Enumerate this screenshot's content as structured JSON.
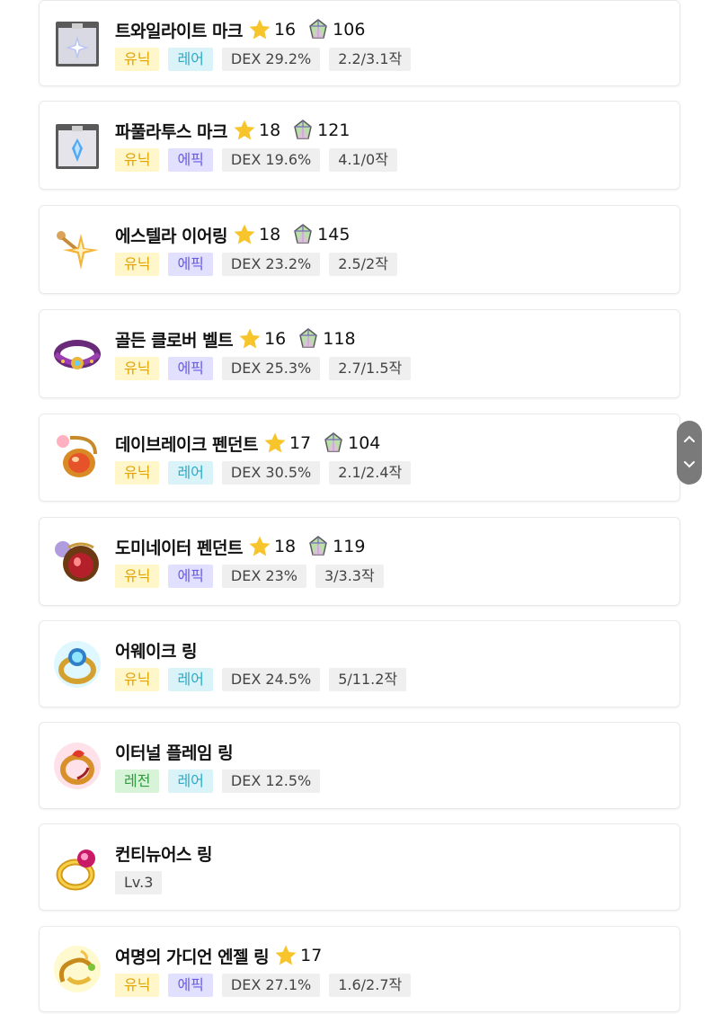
{
  "items": [
    {
      "name": "트와일라이트 마크",
      "stars": "16",
      "power": "106",
      "icon": "twilight-mark-icon",
      "tags": [
        {
          "text": "유닉",
          "kind": "unique"
        },
        {
          "text": "레어",
          "kind": "rare"
        },
        {
          "text": "DEX 29.2%",
          "kind": "stat"
        },
        {
          "text": "2.2/3.1작",
          "kind": "stat"
        }
      ]
    },
    {
      "name": "파풀라투스 마크",
      "stars": "18",
      "power": "121",
      "icon": "papulatus-mark-icon",
      "tags": [
        {
          "text": "유닉",
          "kind": "unique"
        },
        {
          "text": "에픽",
          "kind": "epic"
        },
        {
          "text": "DEX 19.6%",
          "kind": "stat"
        },
        {
          "text": "4.1/0작",
          "kind": "stat"
        }
      ]
    },
    {
      "name": "에스텔라 이어링",
      "stars": "18",
      "power": "145",
      "icon": "estella-earring-icon",
      "tags": [
        {
          "text": "유닉",
          "kind": "unique"
        },
        {
          "text": "에픽",
          "kind": "epic"
        },
        {
          "text": "DEX 23.2%",
          "kind": "stat"
        },
        {
          "text": "2.5/2작",
          "kind": "stat"
        }
      ]
    },
    {
      "name": "골든 클로버 벨트",
      "stars": "16",
      "power": "118",
      "icon": "golden-clover-belt-icon",
      "tags": [
        {
          "text": "유닉",
          "kind": "unique"
        },
        {
          "text": "에픽",
          "kind": "epic"
        },
        {
          "text": "DEX 25.3%",
          "kind": "stat"
        },
        {
          "text": "2.7/1.5작",
          "kind": "stat"
        }
      ]
    },
    {
      "name": "데이브레이크 펜던트",
      "stars": "17",
      "power": "104",
      "icon": "daybreak-pendant-icon",
      "tags": [
        {
          "text": "유닉",
          "kind": "unique"
        },
        {
          "text": "레어",
          "kind": "rare"
        },
        {
          "text": "DEX 30.5%",
          "kind": "stat"
        },
        {
          "text": "2.1/2.4작",
          "kind": "stat"
        }
      ]
    },
    {
      "name": "도미네이터 펜던트",
      "stars": "18",
      "power": "119",
      "icon": "dominator-pendant-icon",
      "tags": [
        {
          "text": "유닉",
          "kind": "unique"
        },
        {
          "text": "에픽",
          "kind": "epic"
        },
        {
          "text": "DEX 23%",
          "kind": "stat"
        },
        {
          "text": "3/3.3작",
          "kind": "stat"
        }
      ]
    },
    {
      "name": "어웨이크 링",
      "stars": "",
      "power": "",
      "icon": "awake-ring-icon",
      "tags": [
        {
          "text": "유닉",
          "kind": "unique"
        },
        {
          "text": "레어",
          "kind": "rare"
        },
        {
          "text": "DEX 24.5%",
          "kind": "stat"
        },
        {
          "text": "5/11.2작",
          "kind": "stat"
        }
      ]
    },
    {
      "name": "이터널 플레임 링",
      "stars": "",
      "power": "",
      "icon": "eternal-flame-ring-icon",
      "tags": [
        {
          "text": "레전",
          "kind": "legend"
        },
        {
          "text": "레어",
          "kind": "rare"
        },
        {
          "text": "DEX 12.5%",
          "kind": "stat"
        }
      ]
    },
    {
      "name": "컨티뉴어스 링",
      "stars": "",
      "power": "",
      "icon": "continuous-ring-icon",
      "tags": [
        {
          "text": "Lv.3",
          "kind": "stat"
        }
      ]
    },
    {
      "name": "여명의 가디언 엔젤 링",
      "stars": "17",
      "power": "",
      "icon": "guardian-angel-ring-icon",
      "tags": [
        {
          "text": "유닉",
          "kind": "unique"
        },
        {
          "text": "에픽",
          "kind": "epic"
        },
        {
          "text": "DEX 27.1%",
          "kind": "stat"
        },
        {
          "text": "1.6/2.7작",
          "kind": "stat"
        }
      ]
    }
  ],
  "scroll_controls": {
    "up_icon": "chevron-up-icon",
    "down_icon": "chevron-down-icon"
  },
  "colors": {
    "star": "#f7c52b",
    "unique": "#e3a400",
    "rare": "#2aa9c8",
    "epic": "#6a5ae6",
    "legend": "#2e9c3e"
  }
}
